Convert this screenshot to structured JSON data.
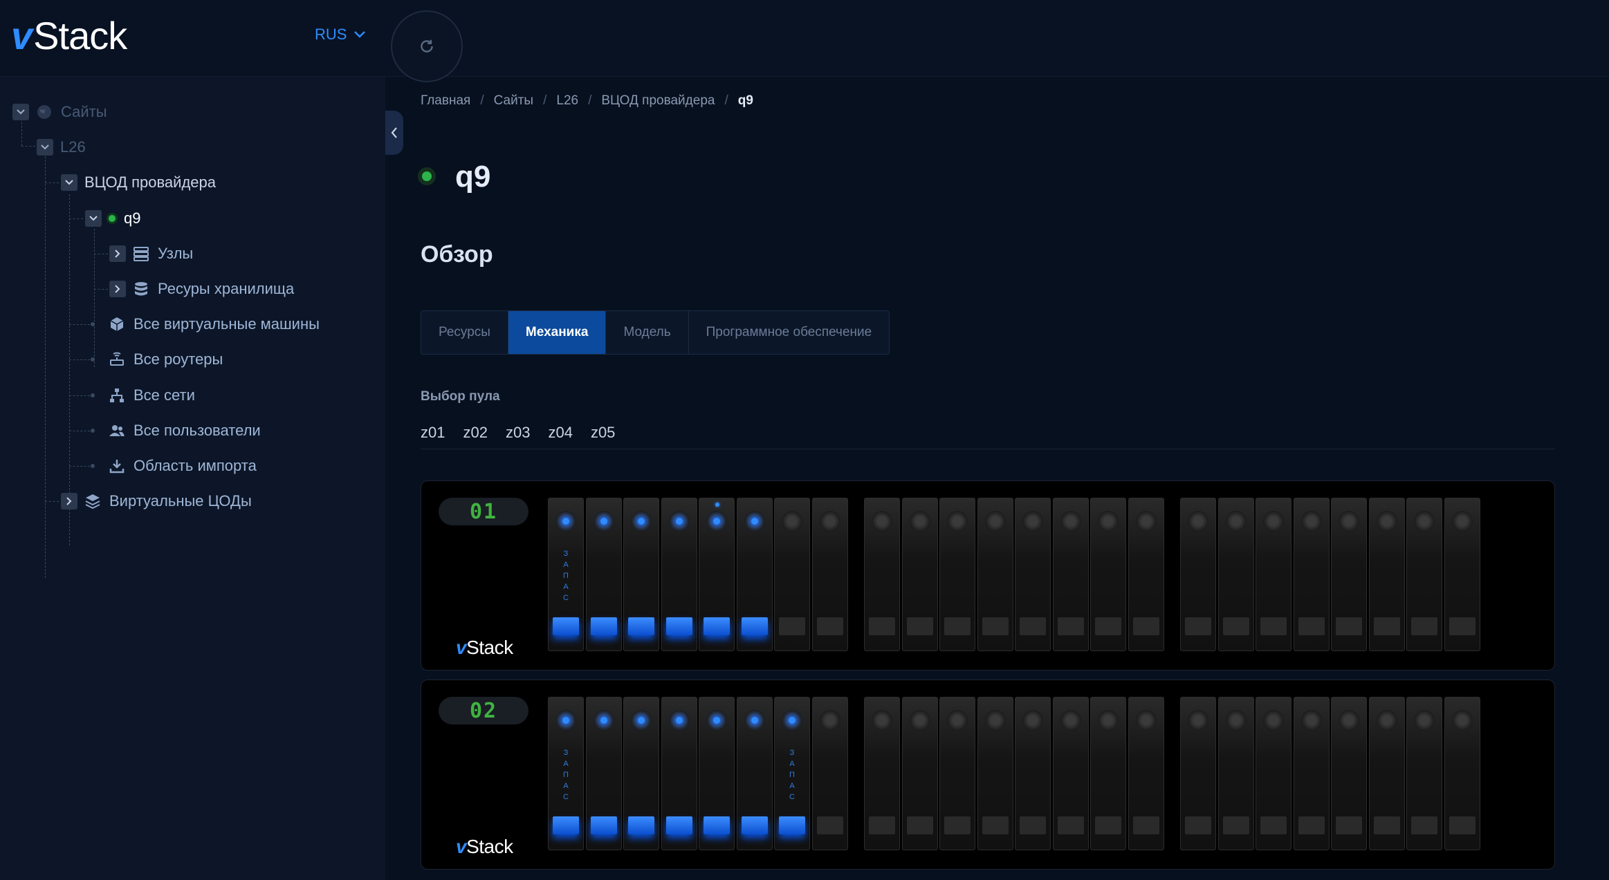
{
  "app": {
    "logo_text": "Stack",
    "logo_v": "v"
  },
  "header": {
    "language": "RUS"
  },
  "tree": {
    "sites": "Сайты",
    "l26": "L26",
    "vcod": "ВЦОД провайдера",
    "q9": "q9",
    "nodes": "Узлы",
    "storage": "Ресуры хранилища",
    "all_vms": "Все виртуальные машины",
    "all_routers": "Все роутеры",
    "all_networks": "Все сети",
    "all_users": "Все пользователи",
    "import_area": "Область импорта",
    "virtual_dcs": "Виртуальные ЦОДы"
  },
  "breadcrumb": [
    "Главная",
    "Сайты",
    "L26",
    "ВЦОД провайдера",
    "q9"
  ],
  "page": {
    "title": "q9",
    "section": "Обзор"
  },
  "tabs": [
    "Ресурсы",
    "Механика",
    "Модель",
    "Программное обеспечение"
  ],
  "active_tab": "Механика",
  "pool": {
    "label": "Выбор пула",
    "options": [
      "z01",
      "z02",
      "z03",
      "z04",
      "z05"
    ]
  },
  "chassis": [
    {
      "id": "01",
      "brand": "Stack",
      "active_bays": [
        1,
        2,
        3,
        4,
        5,
        6
      ],
      "spare_bays": [
        1
      ],
      "spare_text": "ЗАПАС"
    },
    {
      "id": "02",
      "brand": "Stack",
      "active_bays": [
        1,
        2,
        3,
        4,
        5,
        6,
        7
      ],
      "spare_bays": [
        1,
        7
      ],
      "spare_text": "ЗАПАС"
    }
  ],
  "colors": {
    "accent": "#2f8cff",
    "status_ok": "#2db34a",
    "active_tab": "#0b4a9c"
  }
}
